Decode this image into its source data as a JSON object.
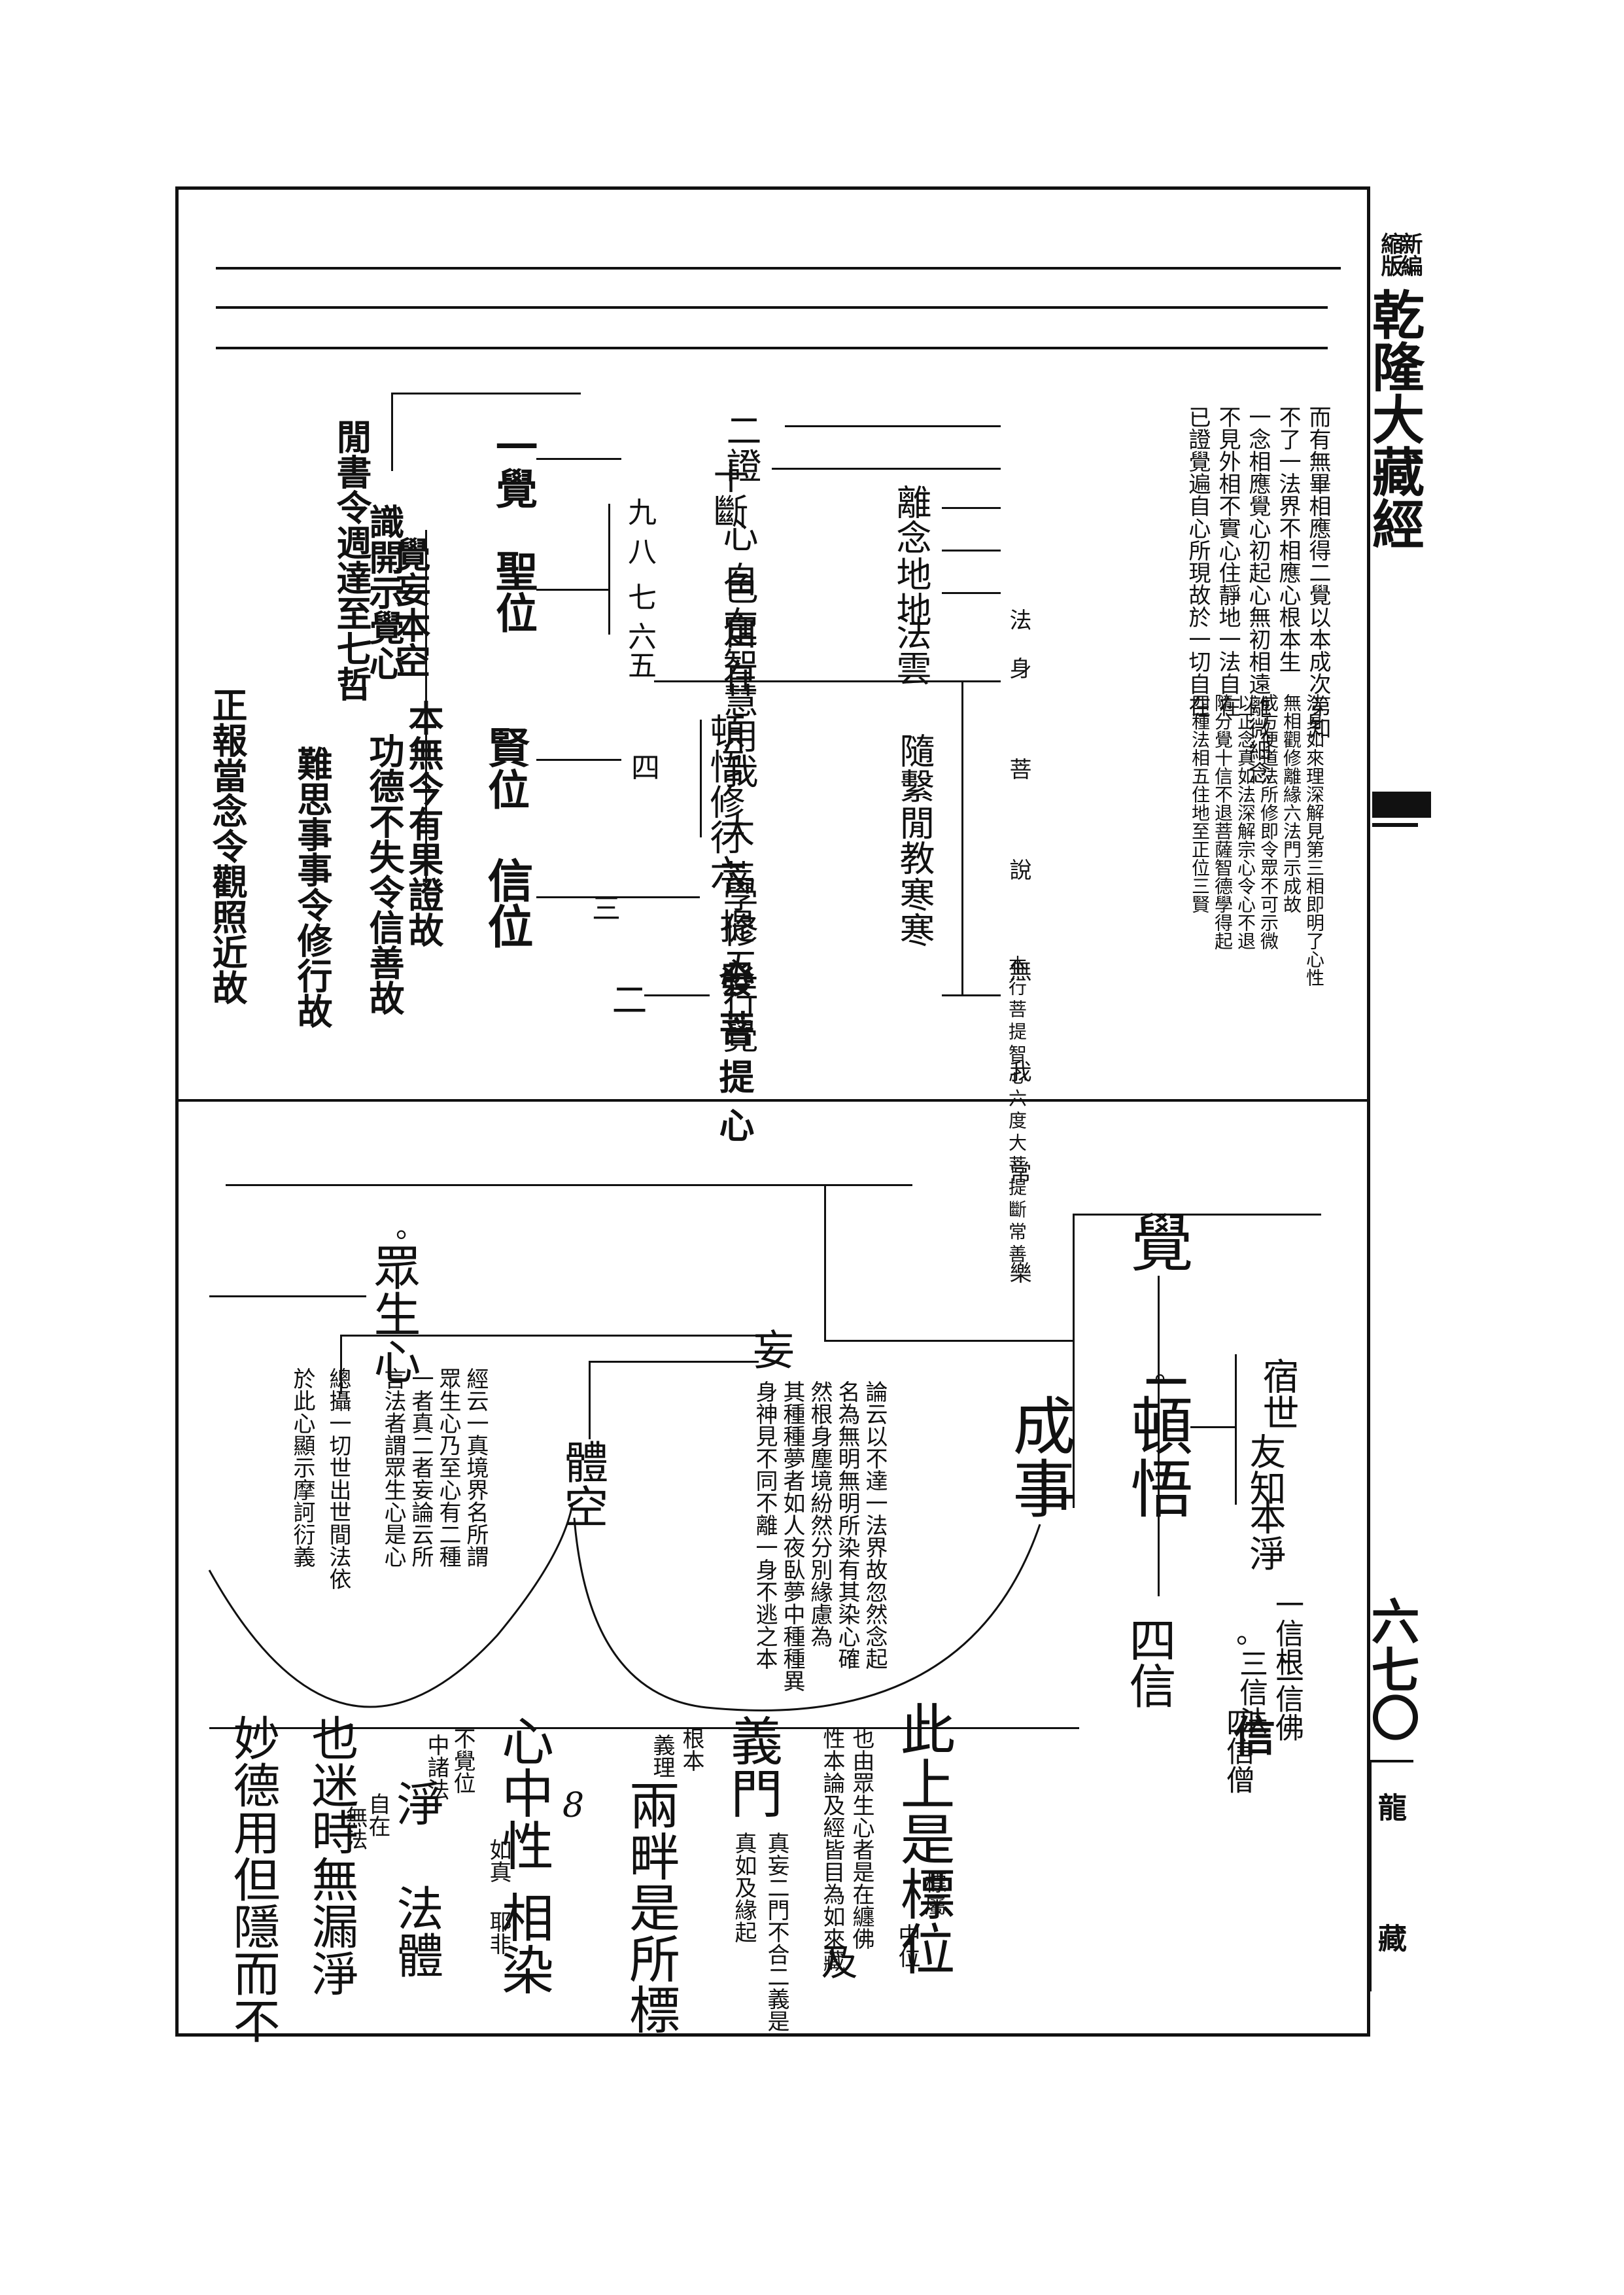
{
  "header": {
    "collection_tag": [
      "新編",
      "縮版"
    ],
    "title": "乾隆大藏經",
    "page_number": "六七〇",
    "series_mark": "龍",
    "series_mark2": "藏"
  },
  "upper": {
    "left_cols": [
      "閒書令週達至七哲",
      "識開示覺心",
      "覺妄本空",
      "本無今有果證故",
      "功德不失令信善故",
      "難思事事令修行故",
      "正報當念令觀照近故"
    ],
    "stages": {
      "yijue": "一覺",
      "shengwei": "聖位",
      "xianwei": "賢位",
      "xinwei": "信位",
      "fa_puti": "發菩提心",
      "num_er": "二",
      "num_si": "四",
      "num_san": "三"
    },
    "mid_cols": [
      "二證",
      "十斷",
      "九",
      "八",
      "七",
      "六五",
      "心自在",
      "色自在",
      "定智慧用我",
      "離念",
      "地地",
      "法雲",
      "隨繫",
      "閒教",
      "寒寒",
      "頓悟修行六",
      "大菩提心",
      "學修五行覺"
    ],
    "notes": [
      "而有無畢相應得二覺以本成次第知",
      "不了一法界不相應心根本生",
      "一念相應覺心初起心無初相遠離微細念",
      "不見外相不實心住靜地一法自在",
      "已證覺遍自心所現故於一切自在",
      "法身 菩 說 無 我 常 樂",
      "法身如來理深解見第三相即明了心性",
      "無相觀修離緣六法門示成故",
      "成方便道法所修即令眾不可示微",
      "以正念真如法深解宗心令心不退",
      "隨分覺十信不退菩薩智德學得起",
      "四種法相五住地至正位三賢",
      "本行菩提智心六度大菩提斷常善"
    ]
  },
  "lower": {
    "jue": "覺",
    "yi": "一",
    "dunwu": "頓悟",
    "si": "四",
    "xin": "信",
    "xin2": "信",
    "chengshi": "成事",
    "wang": "妄",
    "tikong": "體空",
    "zhongshengxin": "眾生心",
    "marks": [
      "。",
      "。",
      "。"
    ],
    "right_branch_top": [
      "宿世",
      "友知",
      "本淨"
    ],
    "right_branch_bottom": [
      "一信根",
      "二信佛",
      "三信法",
      "四信僧"
    ],
    "wang_note": [
      "論云以不達一法界故忽然念起",
      "名為無明無明所染有其染心確",
      "然根身塵境紛然分別緣慮為",
      "其種種夢者如人夜臥夢中種種異",
      "身神見不同不離一身不逃之本"
    ],
    "zhongsheng_note": [
      "經云一真境界名所謂",
      "眾生心乃至心有二種",
      "一者真二者妄論云所",
      "言法者謂眾生心是心",
      "總攝一切世出世間法依",
      "於此心顯示摩訶衍義"
    ],
    "body_cols": [
      "此上是標位",
      "標屬",
      "中位",
      "也由眾生心者是在纏佛",
      "性本論及經皆目為如來藏",
      "及",
      "義門",
      "真妄二門不合二義是",
      "真如及緣起",
      "根本",
      "義理",
      "兩畔是所標",
      "8",
      "心中性",
      "如真",
      "相染",
      "耶非",
      "不覺位",
      "中諸法",
      "淨",
      "自在",
      "無法",
      "法體",
      "也迷時無漏淨",
      "妙德用但隱而不"
    ]
  }
}
